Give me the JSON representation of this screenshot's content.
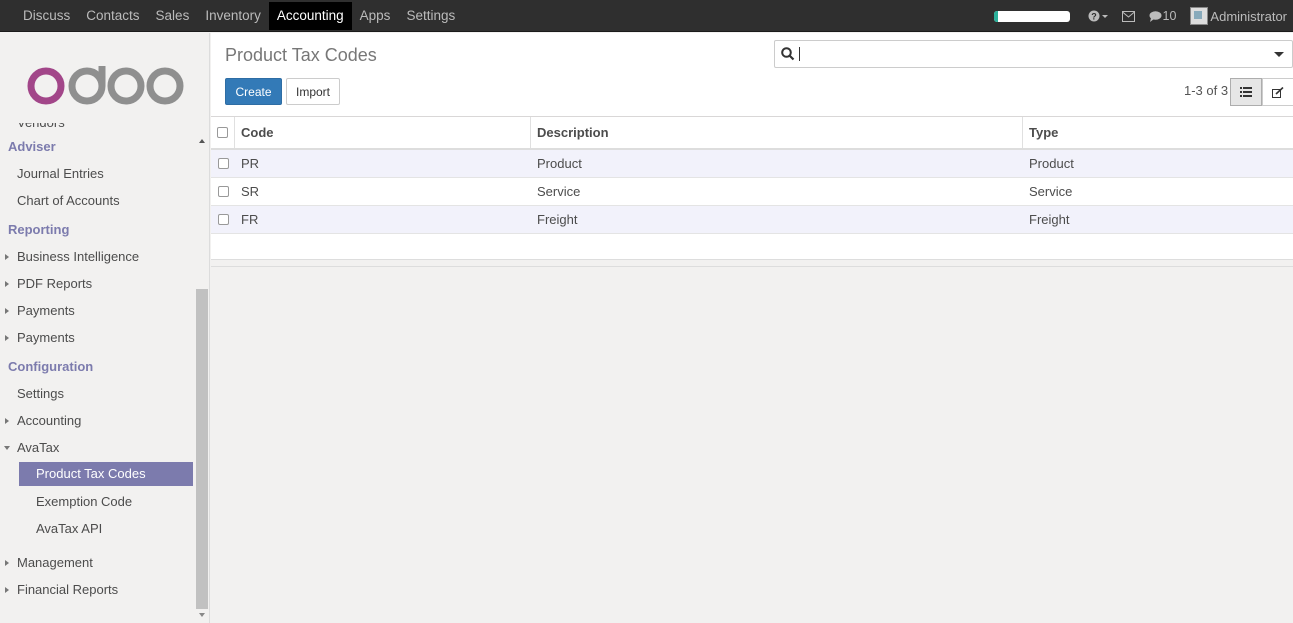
{
  "topnav": {
    "items": [
      "Discuss",
      "Contacts",
      "Sales",
      "Inventory",
      "Accounting",
      "Apps",
      "Settings"
    ],
    "active": "Accounting"
  },
  "topright": {
    "progress": 0.06,
    "help_icon": "question-circle-icon",
    "mail_icon": "envelope-icon",
    "chat_icon": "comment-icon",
    "chat_count": "10",
    "user": "Administrator"
  },
  "sidebar": {
    "logo_text": "odoo",
    "cut_item": "Vendors",
    "adviser_header": "Adviser",
    "adviser_items": [
      "Journal Entries",
      "Chart of Accounts"
    ],
    "reporting_header": "Reporting",
    "reporting_items": [
      "Business Intelligence",
      "PDF Reports",
      "Payments",
      "Payments"
    ],
    "config_header": "Configuration",
    "config_items": {
      "settings": "Settings",
      "accounting": "Accounting",
      "avatax": "AvaTax"
    },
    "avatax_sub": [
      "Product Tax Codes",
      "Exemption Code",
      "AvaTax API"
    ],
    "bottom_items": [
      "Management",
      "Financial Reports"
    ]
  },
  "control_panel": {
    "title": "Product Tax Codes",
    "create_label": "Create",
    "import_label": "Import",
    "search_value": "",
    "pager": "1-3 of 3"
  },
  "table": {
    "headers": [
      "Code",
      "Description",
      "Type"
    ],
    "rows": [
      {
        "code": "PR",
        "description": "Product",
        "type": "Product"
      },
      {
        "code": "SR",
        "description": "Service",
        "type": "Service"
      },
      {
        "code": "FR",
        "description": "Freight",
        "type": "Freight"
      }
    ]
  },
  "colors": {
    "accent": "#7c7bad",
    "primary": "#337ab7",
    "logo": "#a24689"
  }
}
